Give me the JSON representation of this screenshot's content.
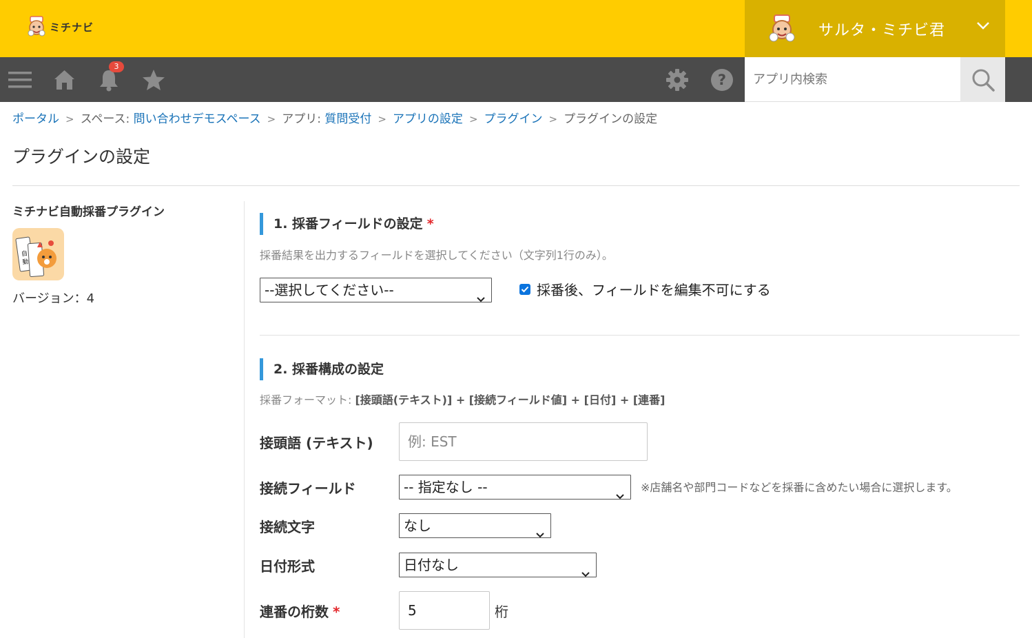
{
  "header": {
    "logo_text": "ミチナビ",
    "user_name": "サルタ・ミチビ君",
    "colors": {
      "brand_yellow": "#ffcc00",
      "user_box": "#d9b100",
      "nav_bg": "#4b4b4b",
      "accent_blue": "#3498db",
      "link": "#1a73b8"
    }
  },
  "nav": {
    "icons": [
      "menu-icon",
      "home-icon",
      "bell-icon",
      "star-icon",
      "gear-icon",
      "help-icon",
      "search-icon"
    ],
    "notification_count": "3",
    "search_placeholder": "アプリ内検索"
  },
  "breadcrumb": {
    "portal": "ポータル",
    "space_prefix": "スペース: ",
    "space_name": "問い合わせデモスペース",
    "app_prefix": "アプリ: ",
    "app_name": "質問受付",
    "app_settings": "アプリの設定",
    "plugins": "プラグイン",
    "current": "プラグインの設定",
    "sep": ">"
  },
  "page": {
    "title": "プラグインの設定"
  },
  "plugin": {
    "name": "ミチナビ自動採番プラグイン",
    "version_label": "バージョン：4"
  },
  "section1": {
    "title": "1. 採番フィールドの設定",
    "required_mark": "*",
    "description": "採番結果を出力するフィールドを選択してください（文字列1行のみ）。",
    "field_select_value": "--選択してください--",
    "lock_checkbox_label": "採番後、フィールドを編集不可にする",
    "lock_checked": true
  },
  "section2": {
    "title": "2. 採番構成の設定",
    "format_prefix": "採番フォーマット: ",
    "format_value": "[接頭語(テキスト)] + [接続フィールド値] + [日付] + [連番]",
    "prefix_label": "接頭語 (テキスト)",
    "prefix_placeholder": "例: EST",
    "join_field_label": "接続フィールド",
    "join_field_value": "-- 指定なし --",
    "join_field_note": "※店舗名や部門コードなどを採番に含めたい場合に選択します。",
    "separator_label": "接続文字",
    "separator_value": "なし",
    "date_format_label": "日付形式",
    "date_format_value": "日付なし",
    "digits_label": "連番の桁数",
    "digits_required": "*",
    "digits_value": "5",
    "digits_unit": "桁"
  }
}
